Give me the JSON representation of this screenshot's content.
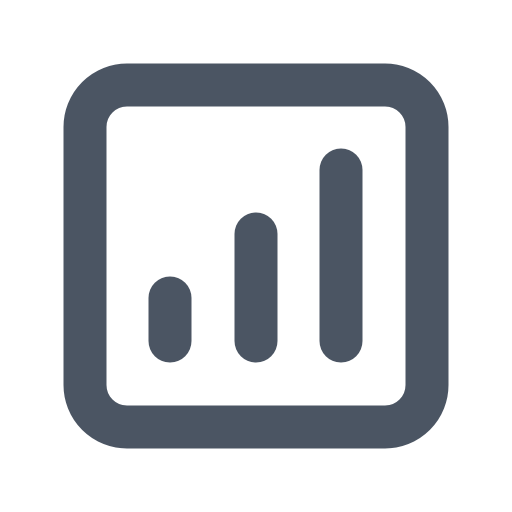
{
  "icon": {
    "name": "chart-bar-square-icon",
    "stroke_color": "#4b5563",
    "background_color": "#ffffff"
  }
}
